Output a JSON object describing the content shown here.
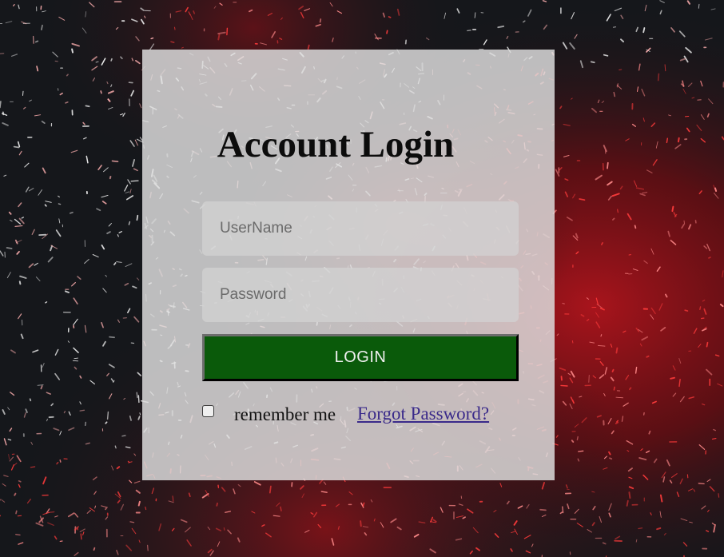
{
  "login_card": {
    "title": "Account Login",
    "username": {
      "placeholder": "UserName",
      "value": ""
    },
    "password": {
      "placeholder": "Password",
      "value": ""
    },
    "login_button_label": "LOGIN",
    "remember_label": "remember me",
    "remember_checked": false,
    "forgot_link": "Forgot Password?"
  },
  "colors": {
    "background": "#15171b",
    "background_accent": "#c41a24",
    "card": "#dedede",
    "login_button": "#0a5a0a",
    "link": "#3a2a8a"
  }
}
